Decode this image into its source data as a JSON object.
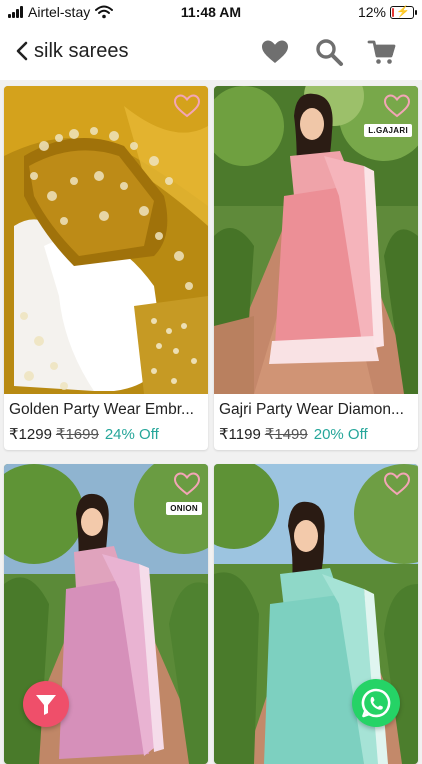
{
  "status_bar": {
    "carrier": "Airtel-stay",
    "time": "11:48 AM",
    "battery_percent": "12%",
    "battery_level": 0.12,
    "battery_color": "#e53935"
  },
  "header": {
    "title": "silk sarees",
    "icons": [
      "back-chevron-icon",
      "heart-icon",
      "search-icon",
      "cart-icon"
    ]
  },
  "products": [
    {
      "name": "Golden Party Wear Embr...",
      "price": "₹1299",
      "mrp": "₹1699",
      "discount": "24% Off",
      "tag": ""
    },
    {
      "name": "Gajri Party Wear Diamon...",
      "price": "₹1199",
      "mrp": "₹1499",
      "discount": "20% Off",
      "tag": "L.GAJARI"
    },
    {
      "name": "",
      "price": "",
      "mrp": "",
      "discount": "",
      "tag": "ONION"
    },
    {
      "name": "",
      "price": "",
      "mrp": "",
      "discount": "",
      "tag": ""
    }
  ],
  "colors": {
    "discount": "#26a69a",
    "filter_button": "#ef4f6a",
    "whatsapp_button": "#25d366",
    "wishlist_heart": "#f3a5b6"
  },
  "fabs": {
    "filter_icon": "filter-icon",
    "whatsapp_icon": "whatsapp-icon"
  }
}
